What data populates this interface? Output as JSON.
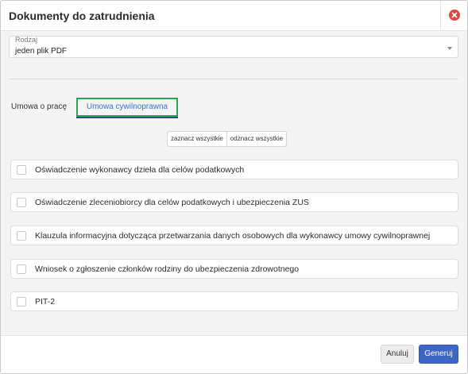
{
  "dialog": {
    "title": "Dokumenty do zatrudnienia"
  },
  "icons": {
    "close": "close-circle-icon",
    "dropdown": "chevron-down-icon"
  },
  "colors": {
    "close": "#e0463f",
    "accent": "#3d66c4",
    "active_tab_border": "#2ea44f",
    "active_tab_text": "#3a6fc8"
  },
  "type_select": {
    "label": "Rodzaj",
    "value": "jeden plik PDF"
  },
  "tabs": [
    {
      "label": "Umowa o pracę",
      "active": false
    },
    {
      "label": "Umowa cywilnoprawna",
      "active": true
    }
  ],
  "selection": {
    "select_all": "zaznacz wszystkie",
    "deselect_all": "odznacz wszystkie"
  },
  "documents": [
    {
      "label": "Oświadczenie wykonawcy dzieła dla celów podatkowych",
      "checked": false
    },
    {
      "label": "Oświadczenie zleceniobiorcy dla celów podatkowych i ubezpieczenia ZUS",
      "checked": false
    },
    {
      "label": "Klauzula informacyjna dotycząca przetwarzania danych osobowych dla wykonawcy umowy cywilnoprawnej",
      "checked": false
    },
    {
      "label": "Wniosek o zgłoszenie członków rodziny do ubezpieczenia zdrowotnego",
      "checked": false
    },
    {
      "label": "PIT-2",
      "checked": false
    }
  ],
  "footer": {
    "cancel": "Anuluj",
    "generate": "Generuj"
  }
}
